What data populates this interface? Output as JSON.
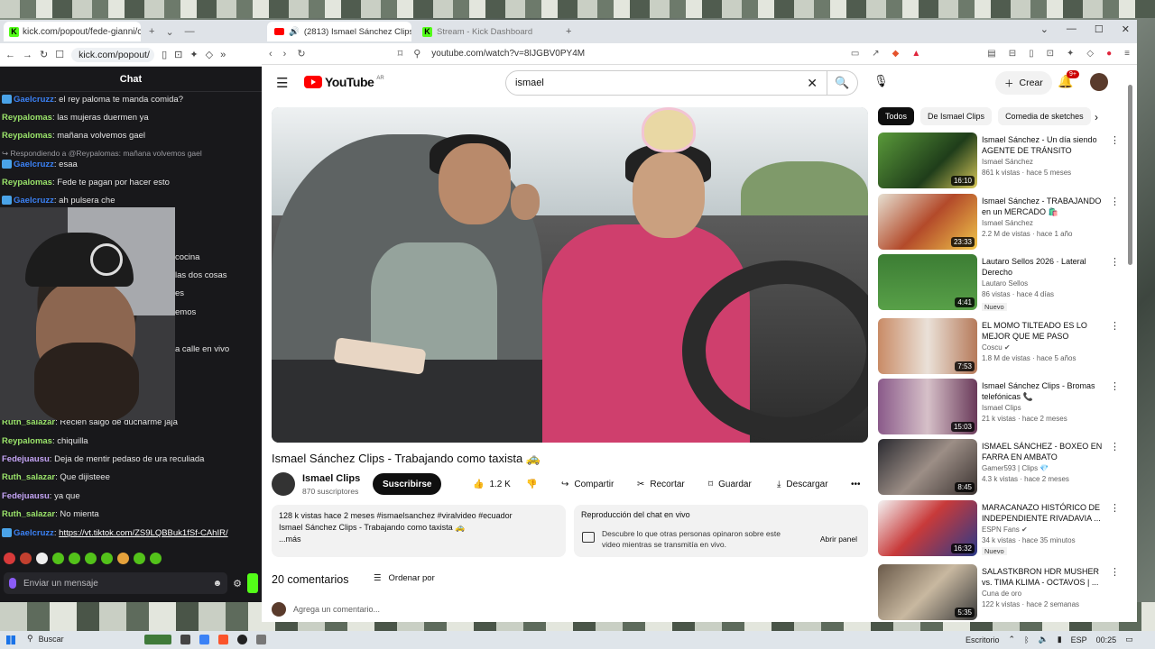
{
  "left_browser": {
    "tab_title": "kick.com/popout/fede-gianni/c",
    "url": "kick.com/popout/",
    "chat_title": "Chat",
    "messages": [
      {
        "user": "Gaelcruzz",
        "text": "el rey paloma te manda comida?",
        "color": "#3b82f6",
        "badge": true
      },
      {
        "user": "Reypalomas",
        "text": "las mujeras duermen ya",
        "color": "#9ae36a",
        "badge": false
      },
      {
        "user": "Reypalomas",
        "text": "mañana volvemos gael",
        "color": "#9ae36a",
        "badge": false
      },
      {
        "reply": "Respondiendo a @Reypalomas: mañana volvemos gael"
      },
      {
        "user": "Gaelcruzz",
        "text": "esaa",
        "color": "#3b82f6",
        "badge": true
      },
      {
        "user": "Reypalomas",
        "text": "Fede te pagan por hacer esto",
        "color": "#9ae36a",
        "badge": false
      },
      {
        "user": "Gaelcruzz",
        "text": "ah pulsera che",
        "color": "#3b82f6",
        "badge": true
      }
    ],
    "partial_messages": [
      "cocina",
      "las dos cosas",
      "es",
      "emos",
      "a calle en vivo"
    ],
    "messages_bottom": [
      {
        "user": "Ruth_salazar",
        "text": "Recien salgo de ducharme jaja",
        "color": "#9ae36a"
      },
      {
        "user": "Reypalomas",
        "text": "chiquilla",
        "color": "#9ae36a"
      },
      {
        "user": "Fedejuausu",
        "text": "Deja de mentir pedaso de ura reculiada",
        "color": "#c4a4f5"
      },
      {
        "user": "Ruth_salazar",
        "text": "Que dijisteee",
        "color": "#9ae36a"
      },
      {
        "user": "Fedejuausu",
        "text": "ya que",
        "color": "#c4a4f5"
      },
      {
        "user": "Ruth_salazar",
        "text": "No mienta",
        "color": "#9ae36a"
      },
      {
        "user": "Gaelcruzz",
        "text": "https://vt.tiktok.com/ZS9LQBBuk1fSf-CAhIR/",
        "color": "#3b82f6",
        "link": true
      }
    ],
    "input_placeholder": "Enviar un mensaje"
  },
  "right_browser": {
    "tabs": [
      {
        "label": "(2813) Ismael Sánchez Clips -",
        "active": true
      },
      {
        "label": "Stream - Kick Dashboard",
        "active": false
      }
    ],
    "url": "youtube.com/watch?v=8IJGBV0PY4M"
  },
  "youtube": {
    "logo_text": "YouTube",
    "country_code": "AR",
    "search_value": "ismael",
    "create_label": "Crear",
    "notif_count": "9+",
    "video_title": "Ismael Sánchez Clips - Trabajando como taxista 🚕",
    "channel_name": "Ismael Clips",
    "channel_subs": "870 suscriptores",
    "subscribe": "Suscribirse",
    "likes": "1.2 K",
    "share": "Compartir",
    "clip": "Recortar",
    "save": "Guardar",
    "download": "Descargar",
    "desc_meta": "128 k vistas  hace 2 meses  #ismaelsanchez #viralvideo #ecuador",
    "desc_text": "Ismael Sánchez Clips - Trabajando como taxista 🚕",
    "desc_more": "...más",
    "chat_replay_title": "Reproducción del chat en vivo",
    "chat_replay_desc": "Descubre lo que otras personas opinaron sobre este video mientras se transmitía en vivo.",
    "chat_replay_btn": "Abrir panel",
    "comments_count": "20 comentarios",
    "sort_label": "Ordenar por",
    "add_comment": "Agrega un comentario...",
    "chips": [
      "Todos",
      "De Ismael Clips",
      "Comedia de sketches"
    ],
    "recommendations": [
      {
        "title": "Ismael Sánchez - Un día siendo AGENTE DE TRÁNSITO",
        "channel": "Ismael Sánchez",
        "meta": "861 k vistas · hace 5 meses",
        "duration": "16:10",
        "new": false
      },
      {
        "title": "Ismael Sánchez - TRABAJANDO en un MERCADO 🛍️",
        "channel": "Ismael Sánchez",
        "meta": "2.2 M de vistas · hace 1 año",
        "duration": "23:33",
        "new": false
      },
      {
        "title": "Lautaro Sellos 2026 · Lateral Derecho",
        "channel": "Lautaro Sellos",
        "meta": "86 vistas · hace 4 días",
        "duration": "4:41",
        "new": true
      },
      {
        "title": "EL MOMO TILTEADO ES LO MEJOR QUE ME PASO",
        "channel": "Coscu ✔",
        "meta": "1.8 M de vistas · hace 5 años",
        "duration": "7:53",
        "new": false
      },
      {
        "title": "Ismael Sánchez Clips - Bromas telefónicas 📞",
        "channel": "Ismael Clips",
        "meta": "21 k vistas · hace 2 meses",
        "duration": "15:03",
        "new": false
      },
      {
        "title": "ISMAEL SÁNCHEZ - BOXEO EN FARRA EN AMBATO",
        "channel": "Gamer593 | Clips 💎",
        "meta": "4.3 k vistas · hace 2 meses",
        "duration": "8:45",
        "new": false
      },
      {
        "title": "MARACANAZO HISTÓRICO DE INDEPENDIENTE RIVADAVIA ...",
        "channel": "ESPN Fans ✔",
        "meta": "34 k vistas · hace 35 minutos",
        "duration": "16:32",
        "new": true
      },
      {
        "title": "SALASTKBRON HDR MUSHER vs. TIMA KLIMA - OCTAVOS | ...",
        "channel": "Cuna de oro",
        "meta": "122 k vistas · hace 2 semanas",
        "duration": "5:35",
        "new": false
      }
    ]
  },
  "taskbar": {
    "search": "Buscar",
    "desktop": "Escritorio",
    "lang": "ESP",
    "time": "00:25"
  }
}
